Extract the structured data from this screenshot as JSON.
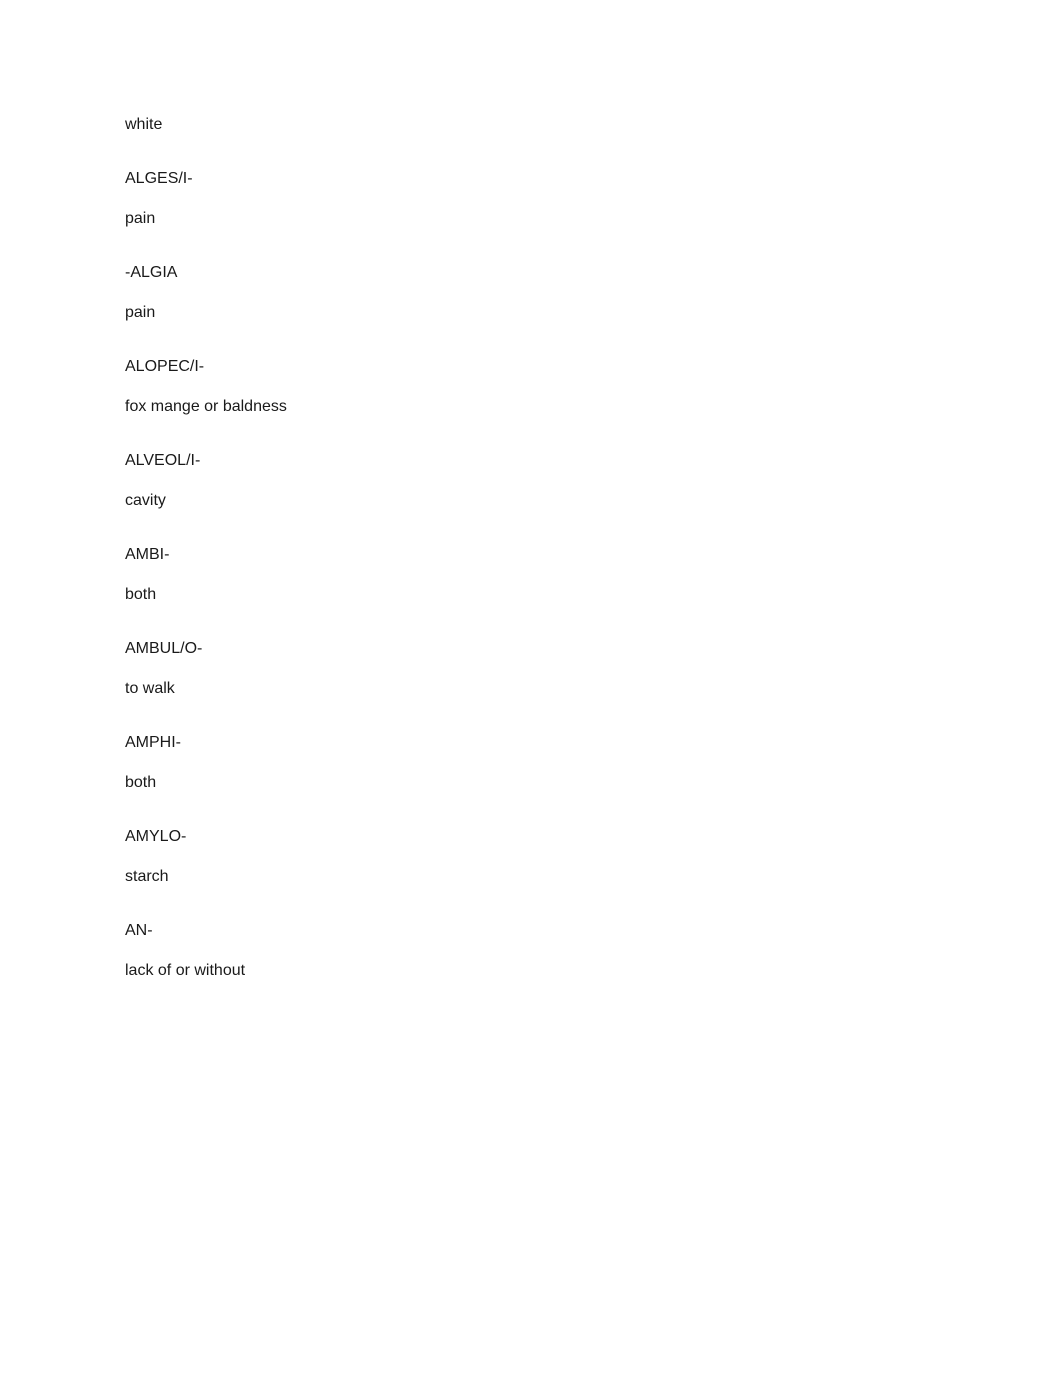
{
  "document": {
    "type": "glossary",
    "background_color": "#ffffff",
    "text_color": "#1a1a1a",
    "entries": [
      {
        "term": "white",
        "definition": ""
      },
      {
        "term": "ALGES/I-",
        "definition": "pain"
      },
      {
        "term": "-ALGIA",
        "definition": "pain"
      },
      {
        "term": "ALOPEC/I-",
        "definition": "fox mange or baldness"
      },
      {
        "term": "ALVEOL/I-",
        "definition": "cavity"
      },
      {
        "term": "AMBI-",
        "definition": "both"
      },
      {
        "term": "AMBUL/O-",
        "definition": "to walk"
      },
      {
        "term": "AMPHI-",
        "definition": "both"
      },
      {
        "term": "AMYLO-",
        "definition": "starch"
      },
      {
        "term": "AN-",
        "definition": "lack of or without"
      }
    ]
  }
}
